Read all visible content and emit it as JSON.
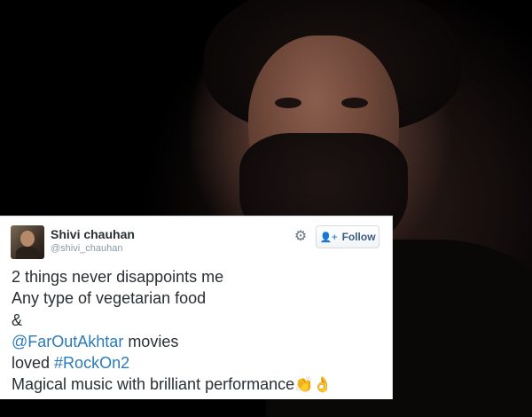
{
  "tweet": {
    "author_name": "Shivi chauhan",
    "author_handle": "@shivi_chauhan",
    "follow_label": "Follow",
    "follow_icon": "person-add-icon",
    "settings_icon": "gear-icon",
    "lines": {
      "l1": "2 things never disappoints me",
      "l2": "Any type of vegetarian food",
      "l3": "&",
      "mention": "@FarOutAkhtar",
      "l4_rest": " movies",
      "l5_pre": "loved ",
      "hashtag": "#RockOn2",
      "l6": "Magical music with brilliant performance",
      "emoji": "👏👌"
    },
    "link_color": "#2b7bb9"
  }
}
